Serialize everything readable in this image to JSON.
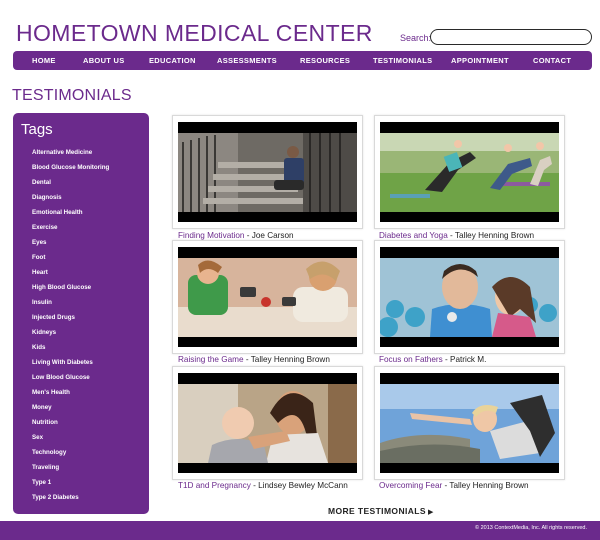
{
  "site": {
    "title": "HOMETOWN MEDICAL CENTER"
  },
  "search": {
    "label": "Search:",
    "value": "",
    "placeholder": ""
  },
  "nav": {
    "items": [
      {
        "label": "HOME"
      },
      {
        "label": "ABOUT US"
      },
      {
        "label": "EDUCATION"
      },
      {
        "label": "ASSESSMENTS"
      },
      {
        "label": "RESOURCES"
      },
      {
        "label": "TESTIMONIALS"
      },
      {
        "label": "APPOINTMENT"
      },
      {
        "label": "CONTACT"
      }
    ]
  },
  "page": {
    "heading": "TESTIMONIALS"
  },
  "sidebar": {
    "title": "Tags",
    "tags": [
      "Alternative Medicine",
      "Blood Glucose Monitoring",
      "Dental",
      "Diagnosis",
      "Emotional Health",
      "Exercise",
      "Eyes",
      "Foot",
      "Heart",
      "High Blood Glucose",
      "Insulin",
      "Injected Drugs",
      "Kidneys",
      "Kids",
      "Living With Diabetes",
      "Low Blood Glucose",
      "Men's Health",
      "Money",
      "Nutrition",
      "Sex",
      "Technology",
      "Traveling",
      "Type 1",
      "Type 2 Diabetes"
    ]
  },
  "videos": [
    {
      "title": "Finding Motivation",
      "separator": " - ",
      "author": "Joe Carson"
    },
    {
      "title": "Diabetes and Yoga",
      "separator": " - ",
      "author": "Talley Henning Brown"
    },
    {
      "title": "Raising the Game",
      "separator": " - ",
      "author": "Talley Henning Brown"
    },
    {
      "title": "Focus on Fathers",
      "separator": " - ",
      "author": "Patrick M."
    },
    {
      "title": "T1D and Pregnancy",
      "separator": " - ",
      "author": "Lindsey Bewley McCann"
    },
    {
      "title": "Overcoming Fear",
      "separator": " - ",
      "author": "Talley Henning Brown"
    }
  ],
  "more": {
    "label": "MORE TESTIMONIALS",
    "arrow": "▶"
  },
  "footer": {
    "copyright": "© 2013 ContextMedia, Inc. All rights reserved."
  },
  "colors": {
    "brand": "#6b2a8c",
    "nav_text": "#ffffff",
    "caption_title": "#6b2a8c"
  }
}
